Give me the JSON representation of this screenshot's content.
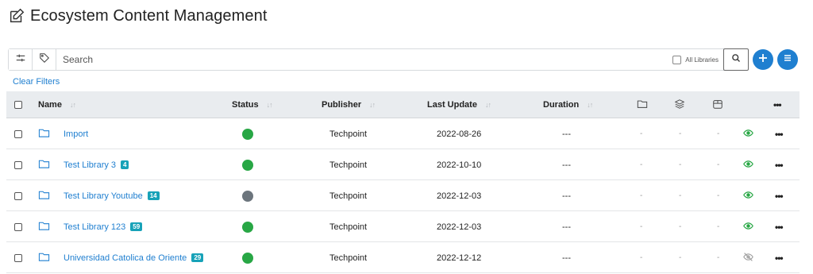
{
  "header": {
    "title": "Ecosystem Content Management"
  },
  "search": {
    "placeholder": "Search",
    "all_libraries_label": "All Libraries"
  },
  "clear_filters_label": "Clear Filters",
  "colors": {
    "accent": "#1f7fd0",
    "badge": "#17a2b8",
    "status_active": "#28a745",
    "status_inactive": "#6c757d",
    "visible_eye": "#28a745",
    "hidden_eye": "#999999"
  },
  "table": {
    "columns": {
      "name": "Name",
      "status": "Status",
      "publisher": "Publisher",
      "last_update": "Last Update",
      "duration": "Duration"
    },
    "icon_columns": [
      "folder-icon",
      "layers-icon",
      "box-icon"
    ],
    "rows": [
      {
        "name": "Import",
        "badge": "",
        "status": "active",
        "publisher": "Techpoint",
        "last_update": "2022-08-26",
        "duration": "---",
        "c1": "-",
        "c2": "-",
        "c3": "-",
        "visible": true
      },
      {
        "name": "Test Library 3",
        "badge": "4",
        "status": "active",
        "publisher": "Techpoint",
        "last_update": "2022-10-10",
        "duration": "---",
        "c1": "-",
        "c2": "-",
        "c3": "-",
        "visible": true
      },
      {
        "name": "Test Library Youtube",
        "badge": "14",
        "status": "inactive",
        "publisher": "Techpoint",
        "last_update": "2022-12-03",
        "duration": "---",
        "c1": "-",
        "c2": "-",
        "c3": "-",
        "visible": true
      },
      {
        "name": "Test Library 123",
        "badge": "59",
        "status": "active",
        "publisher": "Techpoint",
        "last_update": "2022-12-03",
        "duration": "---",
        "c1": "-",
        "c2": "-",
        "c3": "-",
        "visible": true
      },
      {
        "name": "Universidad Catolica de Oriente",
        "badge": "29",
        "status": "active",
        "publisher": "Techpoint",
        "last_update": "2022-12-12",
        "duration": "---",
        "c1": "-",
        "c2": "-",
        "c3": "-",
        "visible": false
      }
    ]
  }
}
